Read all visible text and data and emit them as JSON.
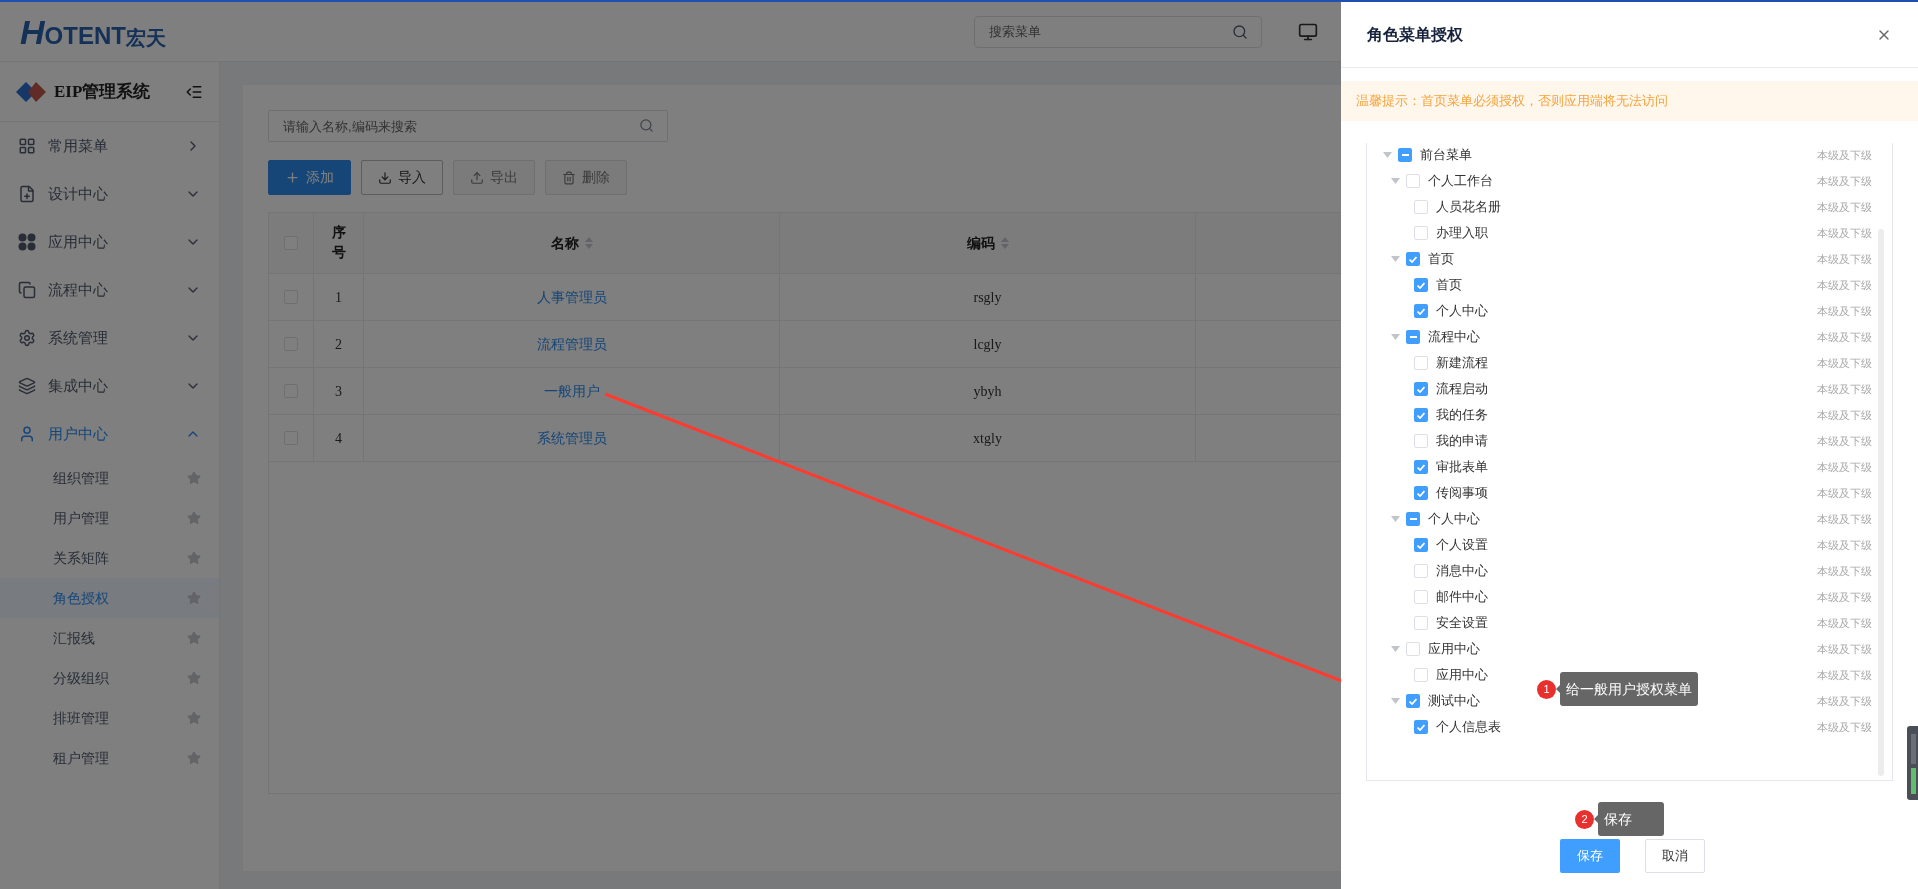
{
  "header": {
    "logo_mark": "H",
    "logo_text": "OTENT",
    "logo_cn": "宏天",
    "search": {
      "placeholder": "搜索菜单"
    }
  },
  "sidebar": {
    "title": "EIP管理系统",
    "items": [
      {
        "label": "常用菜单",
        "kind": "flyout",
        "expanded": false
      },
      {
        "label": "设计中心",
        "kind": "group",
        "expanded": false
      },
      {
        "label": "应用中心",
        "kind": "group",
        "expanded": false
      },
      {
        "label": "流程中心",
        "kind": "group",
        "expanded": false
      },
      {
        "label": "系统管理",
        "kind": "group",
        "expanded": false
      },
      {
        "label": "集成中心",
        "kind": "group",
        "expanded": false
      },
      {
        "label": "用户中心",
        "kind": "group",
        "expanded": true,
        "children": [
          {
            "label": "组织管理",
            "selected": false
          },
          {
            "label": "用户管理",
            "selected": false
          },
          {
            "label": "关系矩阵",
            "selected": false
          },
          {
            "label": "角色授权",
            "selected": true
          },
          {
            "label": "汇报线",
            "selected": false
          },
          {
            "label": "分级组织",
            "selected": false
          },
          {
            "label": "排班管理",
            "selected": false
          },
          {
            "label": "租户管理",
            "selected": false
          }
        ]
      }
    ]
  },
  "toolbar": {
    "search": {
      "placeholder": "请输入名称,编码来搜索"
    },
    "buttons": [
      {
        "label": "添加",
        "kind": "primary",
        "disabled": false
      },
      {
        "label": "导入",
        "kind": "import",
        "disabled": false
      },
      {
        "label": "导出",
        "kind": "export",
        "disabled": true
      },
      {
        "label": "删除",
        "kind": "delete",
        "disabled": true
      }
    ]
  },
  "table": {
    "select_all_checked": false,
    "columns": [
      {
        "label": "序号",
        "sortable": false
      },
      {
        "label": "名称",
        "sortable": true
      },
      {
        "label": "编码",
        "sortable": true
      }
    ],
    "rows": [
      {
        "index": "1",
        "name": "人事管理员",
        "code": "rsgly",
        "checked": false
      },
      {
        "index": "2",
        "name": "流程管理员",
        "code": "lcgly",
        "checked": false
      },
      {
        "index": "3",
        "name": "一般用户",
        "code": "ybyh",
        "checked": false
      },
      {
        "index": "4",
        "name": "系统管理员",
        "code": "xtgly",
        "checked": false
      }
    ]
  },
  "drawer": {
    "title": "角色菜单授权",
    "notice": "温馨提示：首页菜单必须授权，否则应用端将无法访问",
    "tree": [
      {
        "label": "前台菜单",
        "indeterminate": true,
        "expanded": true,
        "scope": "本级及下级",
        "children": [
          {
            "label": "个人工作台",
            "checked": false,
            "indeterminate": false,
            "expanded": true,
            "scope": "本级及下级",
            "children": [
              {
                "label": "人员花名册",
                "checked": false,
                "scope": "本级及下级"
              },
              {
                "label": "办理入职",
                "checked": false,
                "scope": "本级及下级"
              }
            ]
          },
          {
            "label": "首页",
            "checked": true,
            "indeterminate": false,
            "expanded": true,
            "scope": "本级及下级",
            "children": [
              {
                "label": "首页",
                "checked": true,
                "scope": "本级及下级"
              },
              {
                "label": "个人中心",
                "checked": true,
                "scope": "本级及下级"
              }
            ]
          },
          {
            "label": "流程中心",
            "indeterminate": true,
            "expanded": true,
            "scope": "本级及下级",
            "children": [
              {
                "label": "新建流程",
                "checked": false,
                "scope": "本级及下级"
              },
              {
                "label": "流程启动",
                "checked": true,
                "scope": "本级及下级"
              },
              {
                "label": "我的任务",
                "checked": true,
                "scope": "本级及下级"
              },
              {
                "label": "我的申请",
                "checked": false,
                "scope": "本级及下级"
              },
              {
                "label": "审批表单",
                "checked": true,
                "scope": "本级及下级"
              },
              {
                "label": "传阅事项",
                "checked": true,
                "scope": "本级及下级"
              }
            ]
          },
          {
            "label": "个人中心",
            "indeterminate": true,
            "expanded": true,
            "scope": "本级及下级",
            "children": [
              {
                "label": "个人设置",
                "checked": true,
                "scope": "本级及下级"
              },
              {
                "label": "消息中心",
                "checked": false,
                "scope": "本级及下级"
              },
              {
                "label": "邮件中心",
                "checked": false,
                "scope": "本级及下级"
              },
              {
                "label": "安全设置",
                "checked": false,
                "scope": "本级及下级"
              }
            ]
          },
          {
            "label": "应用中心",
            "checked": false,
            "indeterminate": false,
            "expanded": true,
            "scope": "本级及下级",
            "children": [
              {
                "label": "应用中心",
                "checked": false,
                "scope": "本级及下级"
              }
            ]
          },
          {
            "label": "测试中心",
            "checked": true,
            "indeterminate": false,
            "expanded": true,
            "scope": "本级及下级",
            "children": [
              {
                "label": "个人信息表",
                "checked": true,
                "scope": "本级及下级"
              }
            ]
          }
        ]
      }
    ],
    "buttons": [
      {
        "label": "保存",
        "kind": "primary"
      },
      {
        "label": "取消",
        "kind": "default"
      }
    ]
  },
  "annotations": [
    {
      "number": "1",
      "text": "给一般用户授权菜单"
    },
    {
      "number": "2",
      "text": "保存"
    }
  ]
}
